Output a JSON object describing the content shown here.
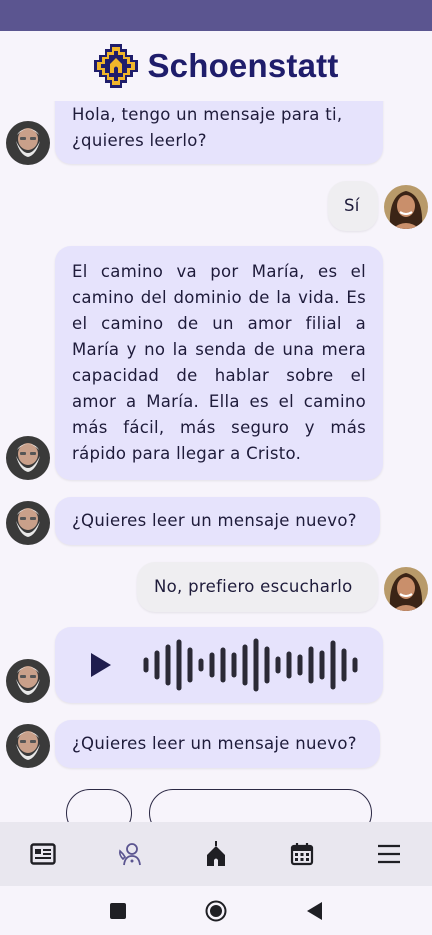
{
  "app": {
    "brand_name": "Schoenstatt",
    "logo_icon": "schoenstatt-shrine-logo"
  },
  "colors": {
    "status_bar": "#5b5590",
    "bot_bubble": "#e6e3fc",
    "user_bubble": "#efeef1",
    "brand_navy": "#1f1d6b",
    "brand_gold": "#f0b62b"
  },
  "messages": [
    {
      "sender": "bot",
      "text": "Hola, tengo un mensaje para ti, ¿quieres leerlo?"
    },
    {
      "sender": "user",
      "text": "Sí"
    },
    {
      "sender": "bot",
      "text": "El camino va por María, es el camino del dominio de la vida. Es el camino de un amor filial a María y no la senda de una mera capacidad de hablar sobre el amor a María. Ella es el camino más fácil, más seguro y más rápido para llegar a Cristo."
    },
    {
      "sender": "bot",
      "text": "¿Quieres leer un mensaje nuevo?"
    },
    {
      "sender": "user",
      "text": "No, prefiero escucharlo"
    },
    {
      "sender": "bot",
      "type": "audio",
      "icons": [
        "play-icon",
        "waveform-icon"
      ]
    },
    {
      "sender": "bot",
      "text": "¿Quieres leer un mensaje nuevo?"
    }
  ],
  "bottom_nav": {
    "items": [
      "news-icon",
      "contact-support-icon",
      "shrine-home-icon",
      "calendar-icon",
      "menu-icon"
    ]
  },
  "system_nav": {
    "items": [
      "recents-icon",
      "home-icon",
      "back-icon"
    ]
  }
}
